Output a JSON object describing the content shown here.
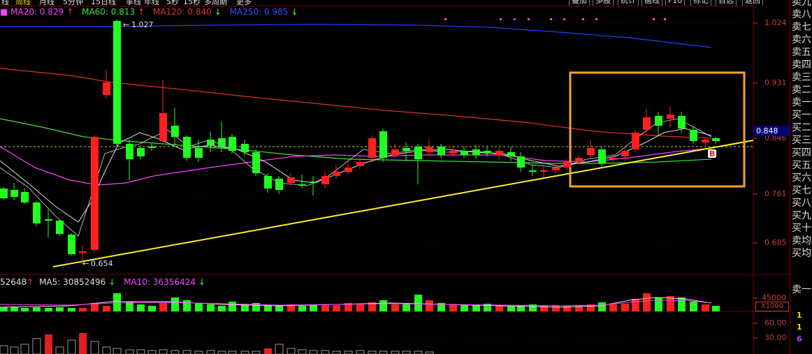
{
  "toolbar": {
    "tabs": [
      "线",
      "周线",
      "月线",
      "5分钟",
      "15日线",
      "季线",
      "年线",
      "5秒",
      "15秒",
      "多周期",
      "更多"
    ],
    "right_buttons": [
      "叠加",
      "多股",
      "统计",
      "画线",
      "F10",
      "标记",
      "自选",
      "返回"
    ]
  },
  "ma_legend": {
    "ma20": "MA20: 0.829",
    "ma20_arrow": "↑",
    "ma60": "MA60: 0.813",
    "ma60_arrow": "↑",
    "ma120": "MA120: 0.840",
    "ma120_arrow": "↓",
    "ma250": "MA250: 0.985",
    "ma250_arrow": "↓"
  },
  "price_axis": {
    "ticks": [
      "1.024",
      "0.931",
      "0.846",
      "0.761",
      "0.685"
    ],
    "current_price": "0.848"
  },
  "annotations": {
    "high": "1.027",
    "low": "0.654",
    "buy_marker": "B"
  },
  "volume_legend": {
    "vol": "52648",
    "vol_arrow": "↑",
    "ma5": "MA5: 30852496",
    "ma5_arrow": "↓",
    "ma10": "MA10: 36356424",
    "ma10_arrow": "↓"
  },
  "volume_axis": {
    "tick": "45000",
    "unit": "X1000"
  },
  "indicator_axis": {
    "ticks": [
      "60.00",
      "30.00"
    ]
  },
  "order_book": {
    "asks": [
      "卖九",
      "卖八",
      "卖七",
      "卖六",
      "卖五",
      "卖四",
      "卖三",
      "卖二",
      "卖一"
    ],
    "bids": [
      "买一",
      "买二",
      "买三",
      "买四",
      "买五",
      "买六",
      "买七",
      "买八",
      "买九",
      "买十"
    ],
    "avg_sell": "卖均",
    "avg_buy": "买均",
    "panel_label": "卖一",
    "values": [
      "1",
      "1",
      "6"
    ]
  },
  "colors": {
    "up": "#ff2020",
    "down": "#20ff20",
    "ma20": "#ff40ff",
    "ma60": "#40e040",
    "ma120": "#e03030",
    "ma250": "#2040ff",
    "trendline": "#ffee33",
    "highlight_box": "#f5a623",
    "axis": "#c83c3c"
  }
}
